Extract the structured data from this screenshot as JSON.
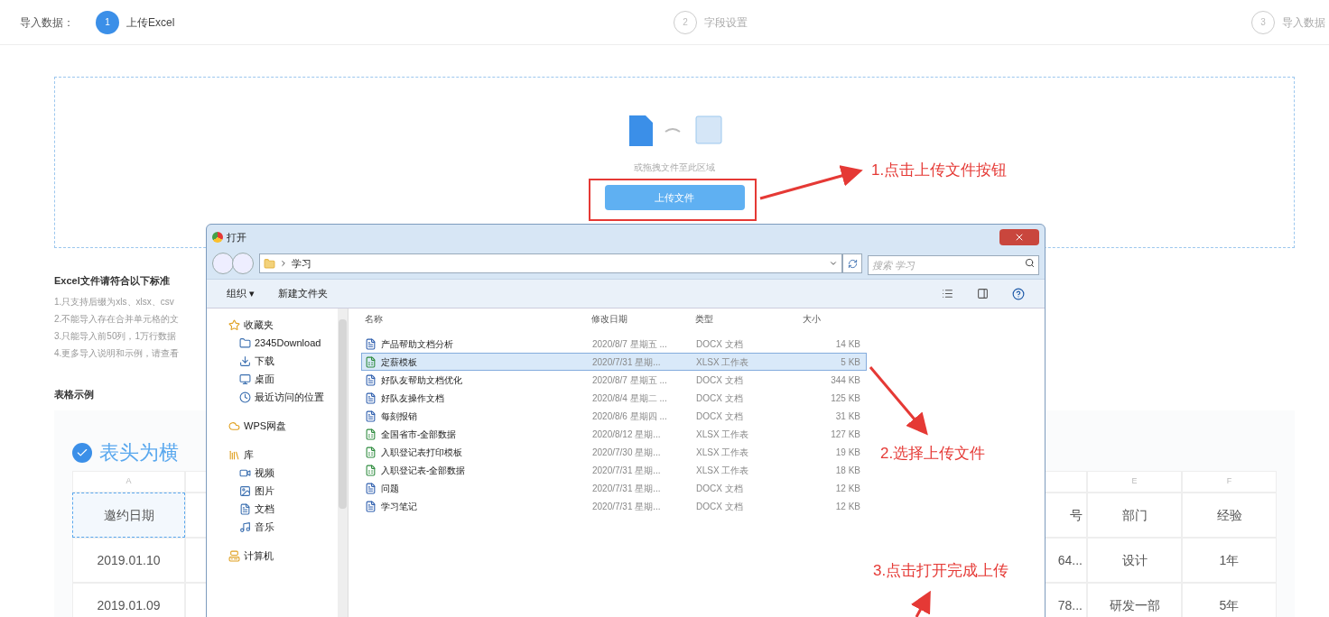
{
  "stepper": {
    "label": "导入数据：",
    "steps": [
      {
        "number": "1",
        "title": "上传Excel",
        "active": true
      },
      {
        "number": "2",
        "title": "字段设置",
        "active": false
      },
      {
        "number": "3",
        "title": "导入数据",
        "active": false
      }
    ]
  },
  "upload": {
    "hint": "或拖拽文件至此区域",
    "button": "上传文件"
  },
  "criteria": {
    "title": "Excel文件请符合以下标准",
    "items": [
      "1.只支持后缀为xls、xlsx、csv",
      "2.不能导入存在合并单元格的文",
      "3.只能导入前50列，1万行数据",
      "4.更多导入说明和示例，请查看"
    ]
  },
  "example": {
    "title": "表格示例",
    "heading": "表头为横",
    "columns": [
      "A",
      "",
      "",
      "E",
      "F"
    ],
    "rows": [
      [
        "邀约日期",
        "",
        "号",
        "部门",
        "经验"
      ],
      [
        "2019.01.10",
        "",
        "64...",
        "设计",
        "1年"
      ],
      [
        "2019.01.09",
        "",
        "78...",
        "研发一部",
        "5年"
      ]
    ]
  },
  "dialog": {
    "title": "打开",
    "path": "学习",
    "search": {
      "placeholder": "搜索 学习"
    },
    "toolbar": [
      "组织 ▾",
      "新建文件夹"
    ],
    "sidebar": [
      {
        "label": "收藏夹",
        "children": [
          {
            "label": "2345Download"
          },
          {
            "label": "下载"
          },
          {
            "label": "桌面"
          },
          {
            "label": "最近访问的位置"
          }
        ]
      },
      {
        "label": "WPS网盘"
      },
      {
        "label": "库",
        "children": [
          {
            "label": "视频"
          },
          {
            "label": "图片"
          },
          {
            "label": "文档"
          },
          {
            "label": "音乐"
          }
        ]
      },
      {
        "label": "计算机"
      }
    ],
    "columns": [
      "名称",
      "修改日期",
      "类型",
      "大小"
    ],
    "files": [
      {
        "name": "产品帮助文档分析",
        "date": "2020/8/7 星期五 ...",
        "type": "DOCX 文档",
        "size": "14 KB",
        "kind": "docx",
        "selected": false
      },
      {
        "name": "定薪模板",
        "date": "2020/7/31 星期...",
        "type": "XLSX 工作表",
        "size": "5 KB",
        "kind": "xlsx",
        "selected": true
      },
      {
        "name": "好队友帮助文档优化",
        "date": "2020/8/7 星期五 ...",
        "type": "DOCX 文档",
        "size": "344 KB",
        "kind": "docx",
        "selected": false
      },
      {
        "name": "好队友操作文档",
        "date": "2020/8/4 星期二 ...",
        "type": "DOCX 文档",
        "size": "125 KB",
        "kind": "docx",
        "selected": false
      },
      {
        "name": "每刻报销",
        "date": "2020/8/6 星期四 ...",
        "type": "DOCX 文档",
        "size": "31 KB",
        "kind": "docx",
        "selected": false
      },
      {
        "name": "全国省市-全部数据",
        "date": "2020/8/12 星期...",
        "type": "XLSX 工作表",
        "size": "127 KB",
        "kind": "xlsx",
        "selected": false
      },
      {
        "name": "入职登记表打印模板",
        "date": "2020/7/30 星期...",
        "type": "XLSX 工作表",
        "size": "19 KB",
        "kind": "xlsx",
        "selected": false
      },
      {
        "name": "入职登记表-全部数据",
        "date": "2020/7/31 星期...",
        "type": "XLSX 工作表",
        "size": "18 KB",
        "kind": "xlsx",
        "selected": false
      },
      {
        "name": "问题",
        "date": "2020/7/31 星期...",
        "type": "DOCX 文档",
        "size": "12 KB",
        "kind": "docx",
        "selected": false
      },
      {
        "name": "学习笔记",
        "date": "2020/7/31 星期...",
        "type": "DOCX 文档",
        "size": "12 KB",
        "kind": "docx",
        "selected": false
      }
    ]
  },
  "annotations": [
    "1.点击上传文件按钮",
    "2.选择上传文件",
    "3.点击打开完成上传"
  ]
}
